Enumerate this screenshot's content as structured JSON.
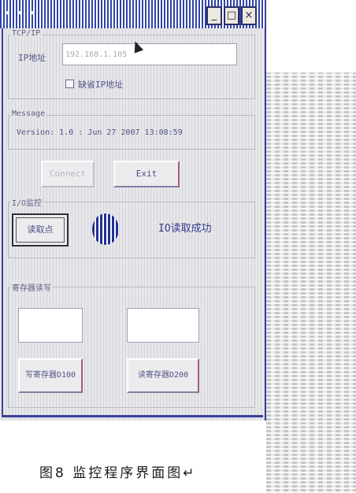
{
  "window": {
    "title": "• • •",
    "min_glyph": "_",
    "max_glyph": "□",
    "close_glyph": "×"
  },
  "tcpip": {
    "group_title": "TCP/IP",
    "ip_label": "IP地址",
    "ip_value": "192.168.1.105",
    "checkbox_label": "缺省IP地址"
  },
  "message": {
    "group_title": "Message",
    "text": "Version: 1.0 : Jun 27 2007 13:08:59"
  },
  "buttons": {
    "connect": "Connect",
    "exit": "Exit"
  },
  "io": {
    "group_title": "I/O监控",
    "read_button": "读取点",
    "status_text": "IO读取成功"
  },
  "registers": {
    "group_title": "寄存器读写",
    "value1": "",
    "value2": "",
    "btn1": "写寄存器D100",
    "btn2": "读寄存器D200"
  },
  "caption": "图8 监控程序界面图↵",
  "colors": {
    "titlebar": "#2f45a8",
    "led": "#233095"
  }
}
